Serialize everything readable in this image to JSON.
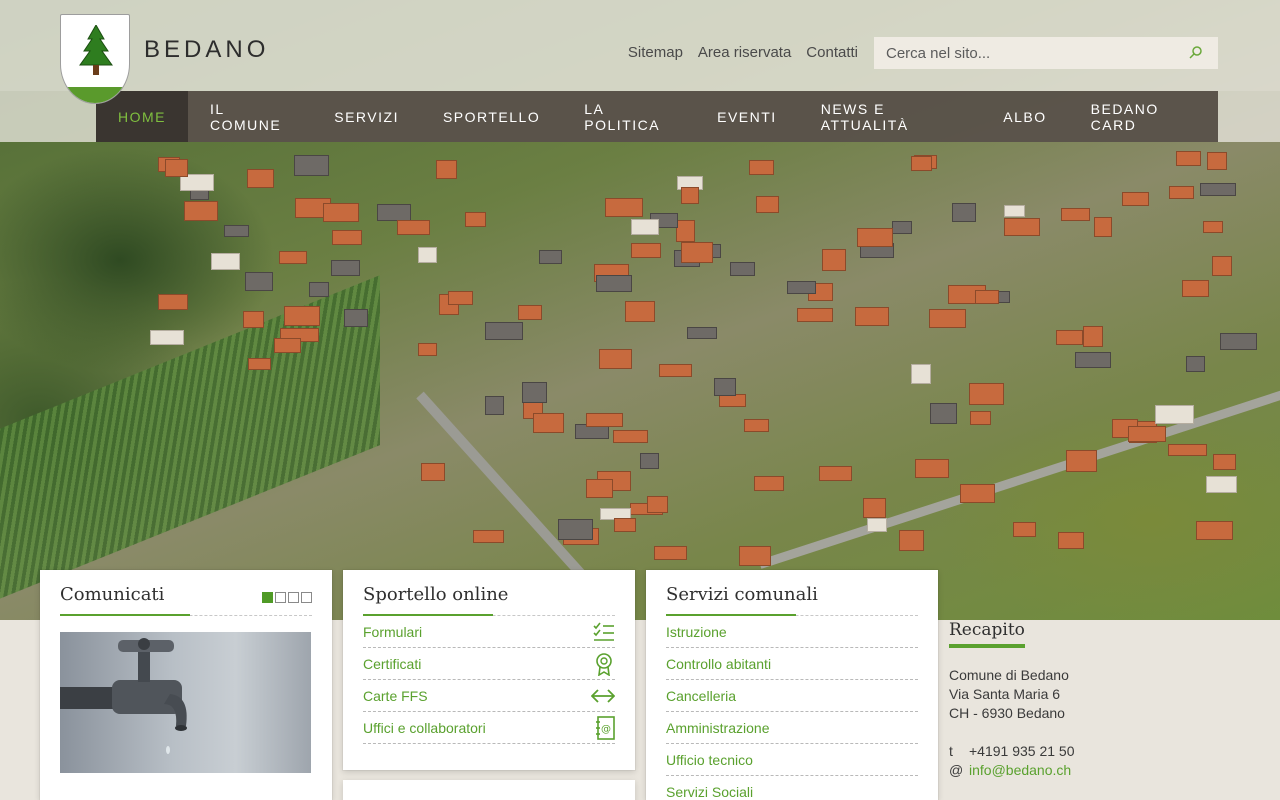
{
  "site": {
    "name": "BEDANO"
  },
  "utility_links": [
    "Sitemap",
    "Area riservata",
    "Contatti"
  ],
  "search": {
    "placeholder": "Cerca nel sito..."
  },
  "nav": {
    "items": [
      "HOME",
      "IL COMUNE",
      "SERVIZI",
      "SPORTELLO",
      "LA POLITICA",
      "EVENTI",
      "NEWS E ATTUALITÀ",
      "ALBO",
      "BEDANO CARD"
    ],
    "active": "HOME"
  },
  "colors": {
    "accent": "#5aa12e",
    "nav_bg": "#4a423a",
    "nav_active_text": "#7fbf3f"
  },
  "comunicati": {
    "title": "Comunicati",
    "pager": {
      "current": 1,
      "total": 4
    },
    "image_icon": "water-tap-photo"
  },
  "sportello": {
    "title": "Sportello online",
    "items": [
      {
        "label": "Formulari",
        "icon": "checklist-icon"
      },
      {
        "label": "Certificati",
        "icon": "certificate-icon"
      },
      {
        "label": "Carte FFS",
        "icon": "arrows-horizontal-icon"
      },
      {
        "label": "Uffici e collaboratori",
        "icon": "contacts-book-icon"
      }
    ]
  },
  "servizi": {
    "title": "Servizi comunali",
    "items": [
      "Istruzione",
      "Controllo abitanti",
      "Cancelleria",
      "Amministrazione",
      "Ufficio tecnico",
      "Servizi Sociali"
    ]
  },
  "recapito": {
    "title": "Recapito",
    "address": [
      "Comune di Bedano",
      "Via Santa Maria 6",
      "CH - 6930 Bedano"
    ],
    "phone_label": "t",
    "phone": "+4191 935 21 50",
    "email_label": "@",
    "email": "info@bedano.ch"
  }
}
